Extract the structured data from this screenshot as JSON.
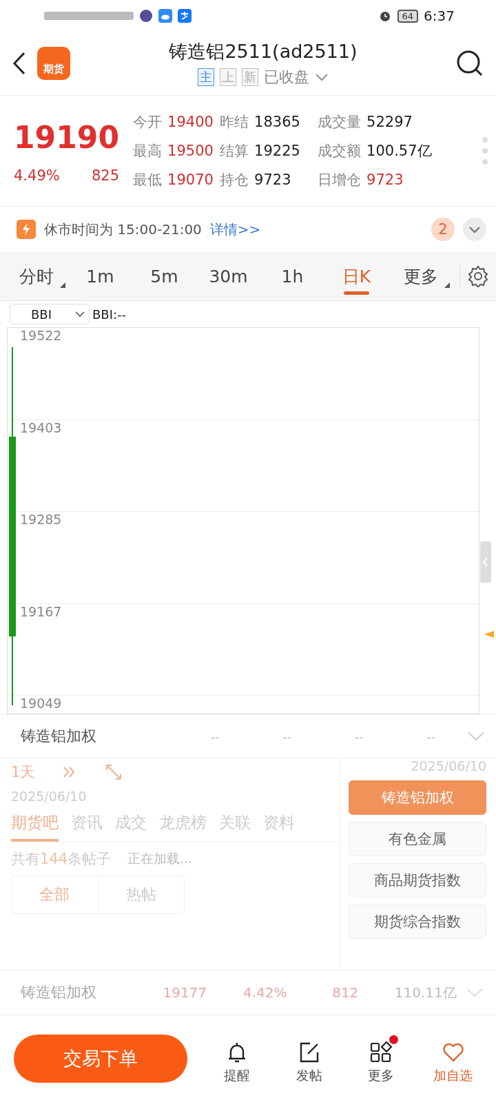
{
  "status_bar": {
    "time": "6:37",
    "battery": "64"
  },
  "header": {
    "logo_text": "期货",
    "title": "铸造铝2511(ad2511)",
    "market_status": "已收盘",
    "badges": [
      {
        "label": "主",
        "selected": true
      },
      {
        "label": "上",
        "selected": false
      },
      {
        "label": "新",
        "selected": false
      }
    ]
  },
  "quote": {
    "price": "19190",
    "change_pct": "4.49%",
    "change": "825",
    "stats": [
      {
        "label": "今开",
        "value": "19400",
        "kind": "up"
      },
      {
        "label": "昨结",
        "value": "18365",
        "kind": "flat"
      },
      {
        "label": "成交量",
        "value": "52297",
        "kind": "flat"
      },
      {
        "label": "最高",
        "value": "19500",
        "kind": "up"
      },
      {
        "label": "结算",
        "value": "19225",
        "kind": "flat"
      },
      {
        "label": "成交额",
        "value": "100.57亿",
        "kind": "flat"
      },
      {
        "label": "最低",
        "value": "19070",
        "kind": "up"
      },
      {
        "label": "持仓",
        "value": "9723",
        "kind": "flat"
      },
      {
        "label": "日增仓",
        "value": "9723",
        "kind": "up"
      }
    ]
  },
  "notice": {
    "text": "休市时间为 15:00-21:00",
    "link": "详情>>",
    "badge": "2"
  },
  "periods": [
    {
      "label": "分时",
      "selected": false,
      "has_menu": true
    },
    {
      "label": "1m",
      "selected": false,
      "has_menu": false
    },
    {
      "label": "5m",
      "selected": false,
      "has_menu": false
    },
    {
      "label": "30m",
      "selected": false,
      "has_menu": false
    },
    {
      "label": "1h",
      "selected": false,
      "has_menu": false
    },
    {
      "label": "日K",
      "selected": true,
      "has_menu": false
    },
    {
      "label": "更多",
      "selected": false,
      "has_menu": true
    }
  ],
  "indicator": {
    "select": "BBI",
    "reading": "BBI:--"
  },
  "chart": {
    "y_labels": [
      "19522",
      "19403",
      "19285",
      "19167",
      "19049"
    ]
  },
  "index_row": {
    "name": "铸造铝加权",
    "cells": [
      "--",
      "--",
      "--",
      "--"
    ]
  },
  "range": {
    "label": "1天",
    "start_date": "2025/06/10",
    "end_date": "2025/06/10"
  },
  "index_menu": [
    {
      "label": "铸造铝加权",
      "selected": true
    },
    {
      "label": "有色金属",
      "selected": false
    },
    {
      "label": "商品期货指数",
      "selected": false
    },
    {
      "label": "期货综合指数",
      "selected": false
    }
  ],
  "section_tabs": [
    {
      "label": "期货吧",
      "selected": true
    },
    {
      "label": "资讯",
      "selected": false
    },
    {
      "label": "成交",
      "selected": false
    },
    {
      "label": "龙虎榜",
      "selected": false
    },
    {
      "label": "关联",
      "selected": false
    },
    {
      "label": "资料",
      "selected": false
    }
  ],
  "posts": {
    "count_prefix": "共有",
    "count": "144",
    "count_suffix": "条帖子",
    "loading": "正在加载...",
    "filters": [
      {
        "label": "全部",
        "selected": true
      },
      {
        "label": "热帖",
        "selected": false
      }
    ]
  },
  "index_quote": {
    "name": "铸造铝加权",
    "price": "19177",
    "change_pct": "4.42%",
    "change": "812",
    "amount": "110.11亿"
  },
  "bottom_bar": {
    "trade_button": "交易下单",
    "actions": [
      {
        "label": "提醒",
        "kind": "bell",
        "selected": false,
        "dot": false
      },
      {
        "label": "发帖",
        "kind": "edit",
        "selected": false,
        "dot": false
      },
      {
        "label": "更多",
        "kind": "grid",
        "selected": false,
        "dot": true
      },
      {
        "label": "加自选",
        "kind": "heart",
        "selected": true,
        "dot": false
      }
    ]
  }
}
